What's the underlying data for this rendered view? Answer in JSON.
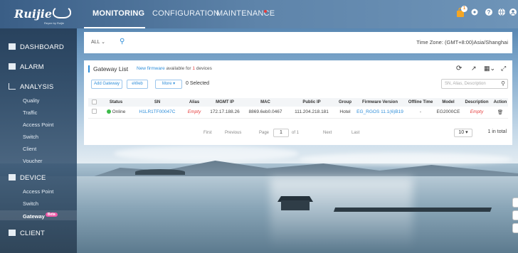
{
  "brand": {
    "logo": "Ruijie",
    "tagline": "Reyee by Ruijie"
  },
  "nav": {
    "monitoring": "MONITORING",
    "configuration": "CONFIGURATION",
    "maintenance": "MAINTENANCE"
  },
  "top_icons": {
    "notification_count": "1"
  },
  "sidebar": {
    "dashboard": "DASHBOARD",
    "alarm": "ALARM",
    "analysis": "ANALYSIS",
    "analysis_items": [
      "Quality",
      "Traffic",
      "Access Point",
      "Switch",
      "Client",
      "Voucher"
    ],
    "device": "DEVICE",
    "device_items": [
      "Access Point",
      "Switch",
      "Gateway"
    ],
    "beta_label": "Beta",
    "client": "CLIENT"
  },
  "filter": {
    "scope": "ALL",
    "timezone": "Time Zone: (GMT+8:00)Asia/Shanghai"
  },
  "gateway": {
    "title": "Gateway List",
    "note_prefix": "New firmware",
    "note_mid": " available for ",
    "note_count": "1",
    "note_suffix": " devices",
    "add_button": "Add Gateway",
    "eweb_button": "eWeb",
    "more_button": "More",
    "selected": "0 Selected",
    "search_placeholder": "SN, Alias, Description",
    "columns": [
      "Status",
      "SN",
      "Alias",
      "MGMT IP",
      "MAC",
      "Public IP",
      "Group",
      "Firmware Version",
      "Offline Time",
      "Model",
      "Description",
      "Action"
    ],
    "rows": [
      {
        "status": "Online",
        "sn": "H1LR1TF00047C",
        "alias": "Empty",
        "mgmt_ip": "172.17.188.26",
        "mac": "8869.6eb0.0467",
        "public_ip": "111.204.218.181",
        "group": "Hotel",
        "firmware": "EG_RGOS 11.1(6)B19",
        "offline_time": "-",
        "model": "EG2000CE",
        "description": "Empty"
      }
    ],
    "pager": {
      "first": "First",
      "previous": "Previous",
      "page_label": "Page",
      "page": "1",
      "of": "of 1",
      "next": "Next",
      "last": "Last",
      "page_size": "10",
      "total": "1 in total"
    }
  }
}
